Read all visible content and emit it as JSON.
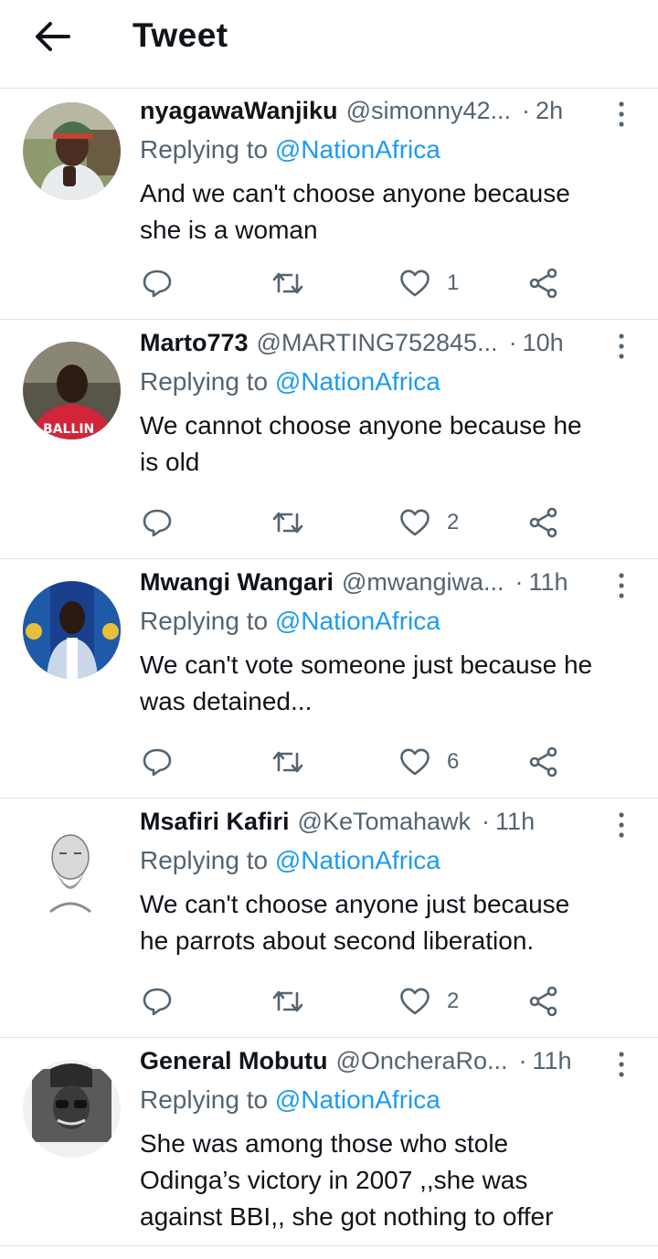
{
  "header": {
    "title": "Tweet",
    "back_icon": "arrow-left-icon"
  },
  "tweets": [
    {
      "name": "nyagawaWanjiku",
      "handle": "@simonny42...",
      "time": "2h",
      "replying_prefix": "Replying to",
      "replying_to": "@NationAfrica",
      "lines": [
        "And we can't choose anyone because",
        "she is a woman"
      ],
      "likes": "1"
    },
    {
      "name": "Marto773",
      "handle": "@MARTING752845...",
      "time": "10h",
      "replying_prefix": "Replying to",
      "replying_to": "@NationAfrica",
      "lines": [
        "We cannot choose anyone because he",
        "is old"
      ],
      "likes": "2"
    },
    {
      "name": "Mwangi Wangari",
      "handle": "@mwangiwa...",
      "time": "11h",
      "replying_prefix": "Replying to",
      "replying_to": "@NationAfrica",
      "lines": [
        "We can't vote someone just because he",
        "was detained..."
      ],
      "likes": "6"
    },
    {
      "name": "Msafiri Kafiri",
      "handle": "@KeTomahawk",
      "time": "11h",
      "replying_prefix": "Replying to",
      "replying_to": "@NationAfrica",
      "lines": [
        "We can't choose anyone just because",
        "he parrots about second liberation."
      ],
      "likes": "2"
    },
    {
      "name": "General Mobutu",
      "handle": "@OncheraRo...",
      "time": "11h",
      "replying_prefix": "Replying to",
      "replying_to": "@NationAfrica",
      "lines": [
        "She was among those who stole",
        "Odinga’s victory in 2007 ,,she was",
        "against BBI,, she got nothing to offer"
      ],
      "likes": ""
    }
  ],
  "colors": {
    "accent": "#1d9bf0",
    "secondary_text": "#536471",
    "divider": "#dfe3e6"
  }
}
